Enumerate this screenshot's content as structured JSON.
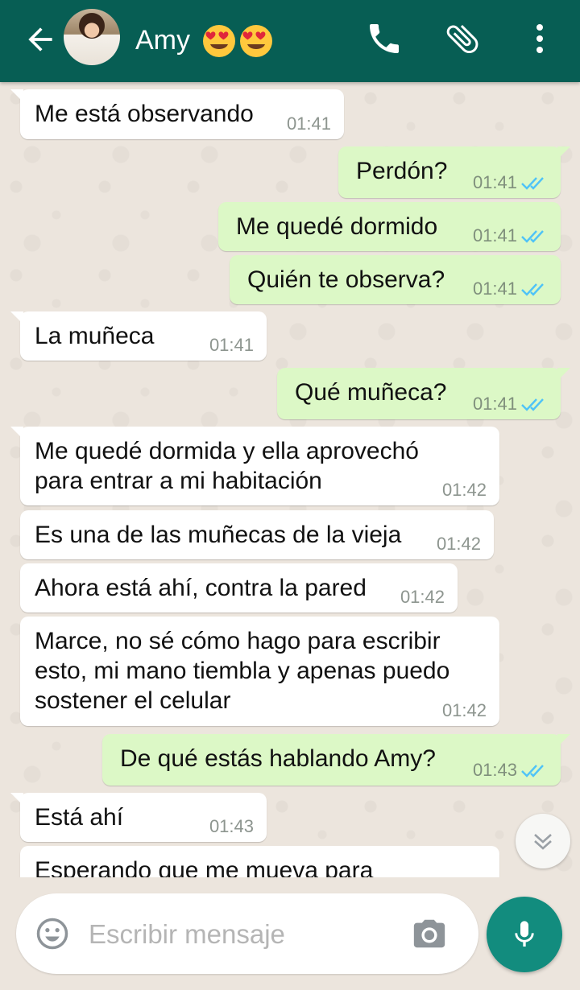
{
  "header": {
    "contact_name": "Amy",
    "name_emojis": [
      "heart-eyes-emoji",
      "heart-eyes-emoji"
    ],
    "icons": [
      "back-arrow-icon",
      "phone-icon",
      "paperclip-icon",
      "more-vert-icon"
    ]
  },
  "messages": [
    {
      "dir": "in",
      "text": "Me está observando",
      "time": "01:41"
    },
    {
      "dir": "out",
      "text": "Perdón?",
      "time": "01:41"
    },
    {
      "dir": "out",
      "text": "Me quedé dormido",
      "time": "01:41"
    },
    {
      "dir": "out",
      "text": "Quién te observa?",
      "time": "01:41"
    },
    {
      "dir": "in",
      "text": "La muñeca",
      "time": "01:41"
    },
    {
      "dir": "out",
      "text": "Qué muñeca?",
      "time": "01:41"
    },
    {
      "dir": "in",
      "text": "Me quedé dormida y ella aprovechó\npara entrar a mi habitación",
      "time": "01:42"
    },
    {
      "dir": "in",
      "text": "Es una de las muñecas de la vieja",
      "time": "01:42"
    },
    {
      "dir": "in",
      "text": "Ahora está ahí, contra la pared",
      "time": "01:42"
    },
    {
      "dir": "in",
      "text": "Marce, no sé cómo hago para escribir\nesto, mi mano tiembla y apenas puedo\nsostener el celular",
      "time": "01:42"
    },
    {
      "dir": "out",
      "text": "De qué estás hablando Amy?",
      "time": "01:43"
    },
    {
      "dir": "in",
      "text": "Está ahí",
      "time": "01:43"
    },
    {
      "dir": "in",
      "text": "Esperando que me mueva para",
      "time": ""
    }
  ],
  "composer": {
    "placeholder": "Escribir mensaje"
  },
  "colors": {
    "header": "#075e54",
    "incoming": "#ffffff",
    "outgoing": "#dcf8c6",
    "read_ticks": "#4fc3f7",
    "mic_button": "#128c7e",
    "background": "#ece5dd"
  }
}
